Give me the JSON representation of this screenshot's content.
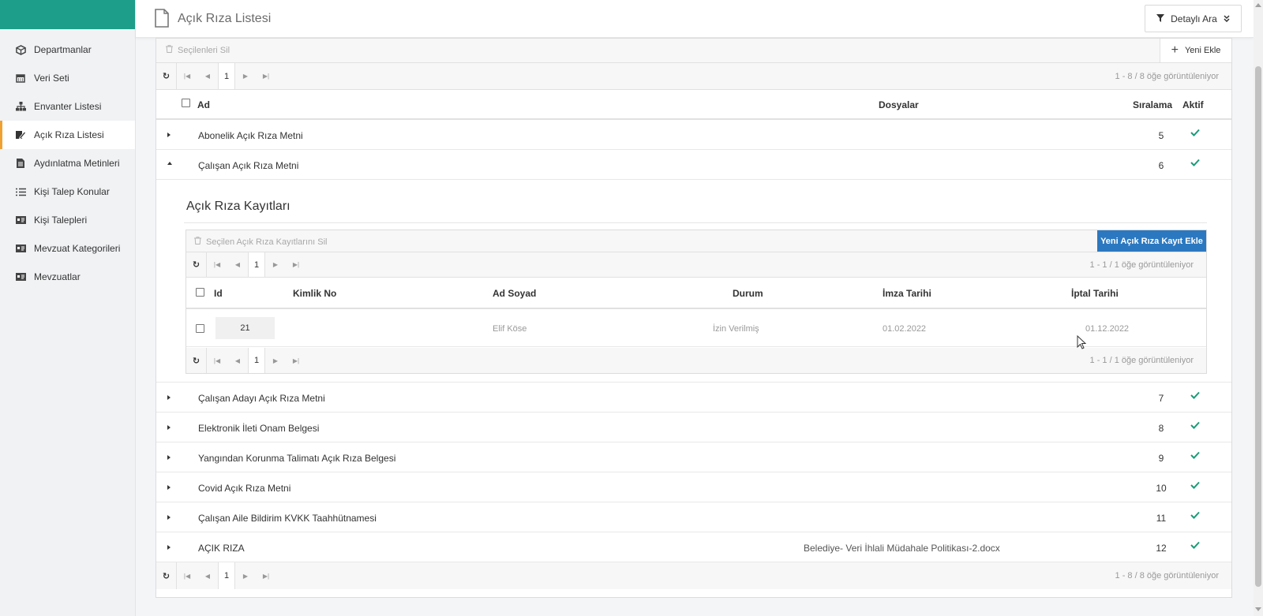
{
  "header": {
    "title": "Açık Rıza Listesi",
    "detail_search": "Detaylı Ara"
  },
  "sidebar": {
    "items": [
      {
        "label": "Departmanlar",
        "icon": "cube-icon"
      },
      {
        "label": "Veri Seti",
        "icon": "calendar-icon"
      },
      {
        "label": "Envanter Listesi",
        "icon": "sitemap-icon"
      },
      {
        "label": "Açık Rıza Listesi",
        "icon": "edit-document-icon",
        "active": true
      },
      {
        "label": "Aydınlatma Metinleri",
        "icon": "file-text-icon"
      },
      {
        "label": "Kişi Talep Konular",
        "icon": "list-icon"
      },
      {
        "label": "Kişi Talepleri",
        "icon": "id-card-icon"
      },
      {
        "label": "Mevzuat Kategorileri",
        "icon": "id-card-icon"
      },
      {
        "label": "Mevzuatlar",
        "icon": "id-card-icon"
      }
    ]
  },
  "grid": {
    "delete_selected": "Seçilenleri Sil",
    "add_new": "Yeni Ekle",
    "page": "1",
    "info": "1 - 8 / 8 öğe görüntüleniyor",
    "columns": {
      "name": "Ad",
      "files": "Dosyalar",
      "order": "Sıralama",
      "active": "Aktif"
    },
    "rows": [
      {
        "name": "Abonelik Açık Rıza Metni",
        "files": "",
        "order": "5"
      },
      {
        "name": "Çalışan Açık Rıza Metni",
        "files": "",
        "order": "6",
        "expanded": true
      },
      {
        "name": "Çalışan Adayı Açık Rıza Metni",
        "files": "",
        "order": "7"
      },
      {
        "name": "Elektronik İleti Onam Belgesi",
        "files": "",
        "order": "8"
      },
      {
        "name": "Yangından Korunma Talimatı Açık Rıza Belgesi",
        "files": "",
        "order": "9"
      },
      {
        "name": "Covid Açık Rıza Metni",
        "files": "",
        "order": "10"
      },
      {
        "name": "Çalışan Aile Bildirim KVKK Taahhütnamesi",
        "files": "",
        "order": "11"
      },
      {
        "name": "AÇIK RIZA",
        "files": "Belediye- Veri İhlali Müdahale Politikası-2.docx",
        "order": "12"
      }
    ]
  },
  "detail": {
    "title": "Açık Rıza Kayıtları",
    "delete_selected": "Seçilen Açık Rıza Kayıtlarını Sil",
    "new_button": "Yeni Açık Rıza Kayıt Ekle",
    "page": "1",
    "info": "1 - 1 / 1 öğe görüntüleniyor",
    "columns": {
      "id": "Id",
      "identity": "Kimlik No",
      "fullname": "Ad Soyad",
      "status": "Durum",
      "sign_date": "İmza Tarihi",
      "cancel_date": "İptal Tarihi"
    },
    "row": {
      "id": "21",
      "identity": "",
      "fullname": "Elif Köse",
      "status": "İzin Verilmiş",
      "sign_date": "01.02.2022",
      "cancel_date": "01.12.2022"
    }
  },
  "colors": {
    "brand": "#1d9e8a",
    "accent": "#f0a030",
    "primary_button": "#2c78c0",
    "check": "#1a9b78"
  }
}
